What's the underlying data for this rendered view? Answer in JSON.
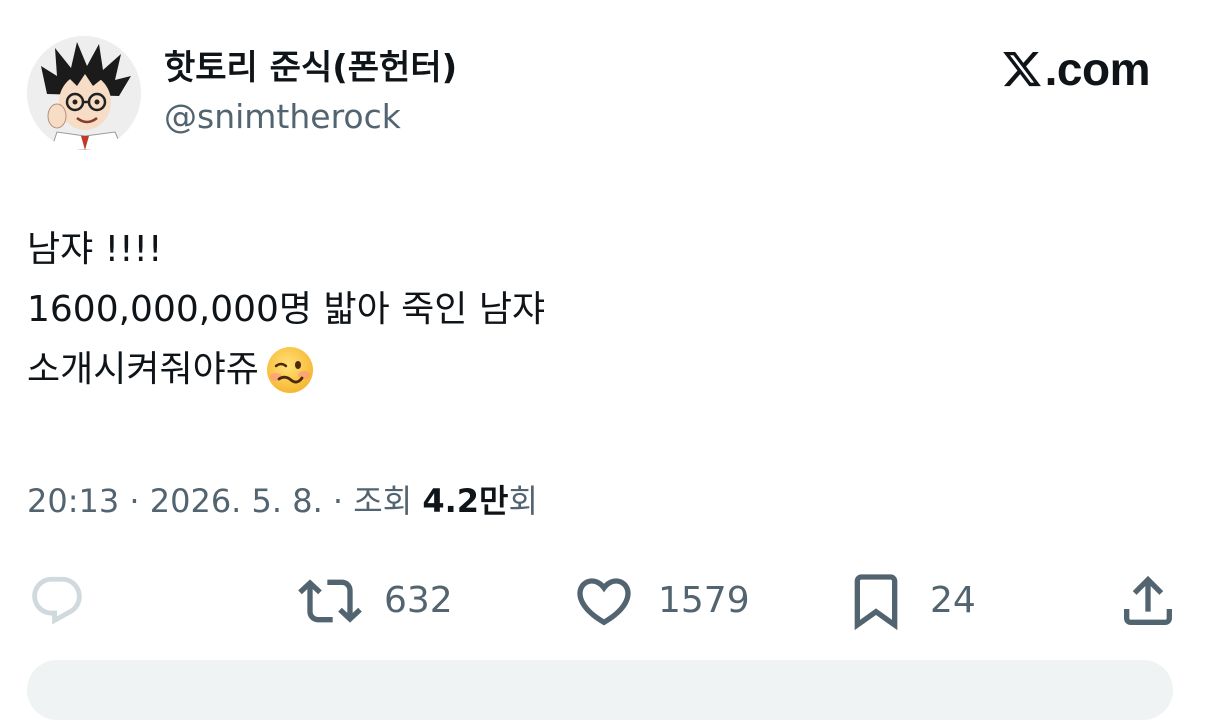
{
  "author": {
    "display_name": "핫토리 준식(폰헌터)",
    "handle": "@snimtherock",
    "avatar_icon": "cartoon-avatar-icon"
  },
  "brand": {
    "label": ".com",
    "logo_icon": "x-logo-icon"
  },
  "tweet": {
    "lines": [
      "남쟈 !!!!",
      "1600,000,000명 밟아 죽인 남쟈",
      "소개시켜줘야쥬"
    ],
    "emoji_icon": "woozy-face-emoji"
  },
  "meta": {
    "time": "20:13",
    "date": "2026. 5. 8.",
    "separator": "·",
    "views_label": "조회",
    "views_count": "4.2만",
    "views_suffix": "회"
  },
  "actions": {
    "reply_icon": "reply-bubble-icon",
    "retweet_count": "632",
    "retweet_icon": "retweet-icon",
    "like_count": "1579",
    "like_icon": "heart-icon",
    "bookmark_count": "24",
    "bookmark_icon": "bookmark-icon",
    "share_icon": "share-icon"
  },
  "colors": {
    "text_primary": "#0f1419",
    "text_secondary": "#536471",
    "reply_icon_muted": "#cfd9de",
    "background": "#ffffff"
  }
}
